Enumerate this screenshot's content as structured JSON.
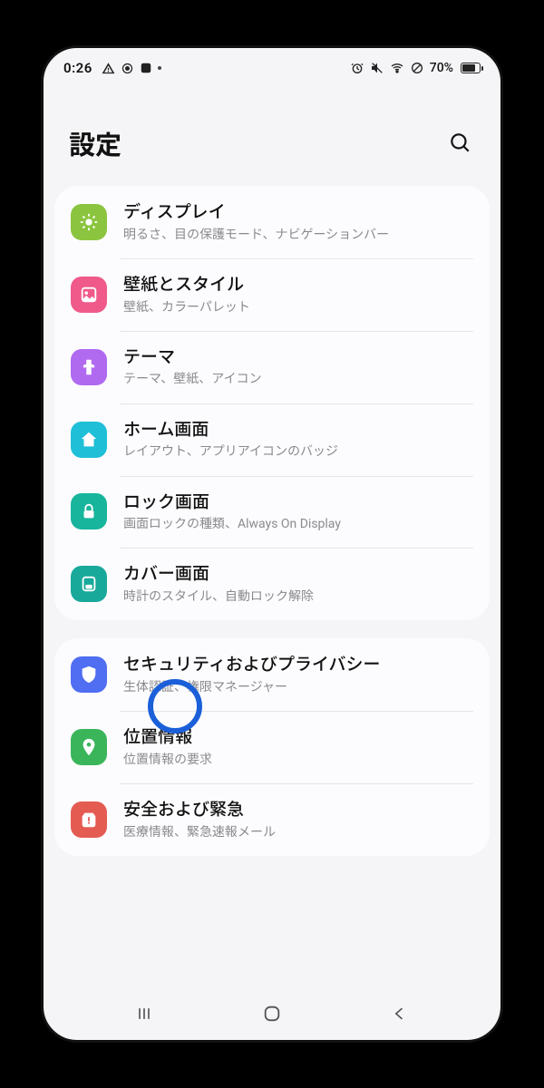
{
  "status": {
    "time": "0:26",
    "battery_pct": "70%"
  },
  "header": {
    "title": "設定"
  },
  "groups": [
    {
      "items": [
        {
          "key": "display",
          "title": "ディスプレイ",
          "sub": "明るさ、目の保護モード、ナビゲーションバー"
        },
        {
          "key": "wallpaper",
          "title": "壁紙とスタイル",
          "sub": "壁紙、カラーパレット"
        },
        {
          "key": "theme",
          "title": "テーマ",
          "sub": "テーマ、壁紙、アイコン"
        },
        {
          "key": "home",
          "title": "ホーム画面",
          "sub": "レイアウト、アプリアイコンのバッジ"
        },
        {
          "key": "lock",
          "title": "ロック画面",
          "sub": "画面ロックの種類、Always On Display"
        },
        {
          "key": "cover",
          "title": "カバー画面",
          "sub": "時計のスタイル、自動ロック解除"
        }
      ]
    },
    {
      "items": [
        {
          "key": "security",
          "title": "セキュリティおよびプライバシー",
          "sub": "生体認証、権限マネージャー"
        },
        {
          "key": "location",
          "title": "位置情報",
          "sub": "位置情報の要求"
        },
        {
          "key": "safety",
          "title": "安全および緊急",
          "sub": "医療情報、緊急速報メール"
        }
      ]
    }
  ]
}
